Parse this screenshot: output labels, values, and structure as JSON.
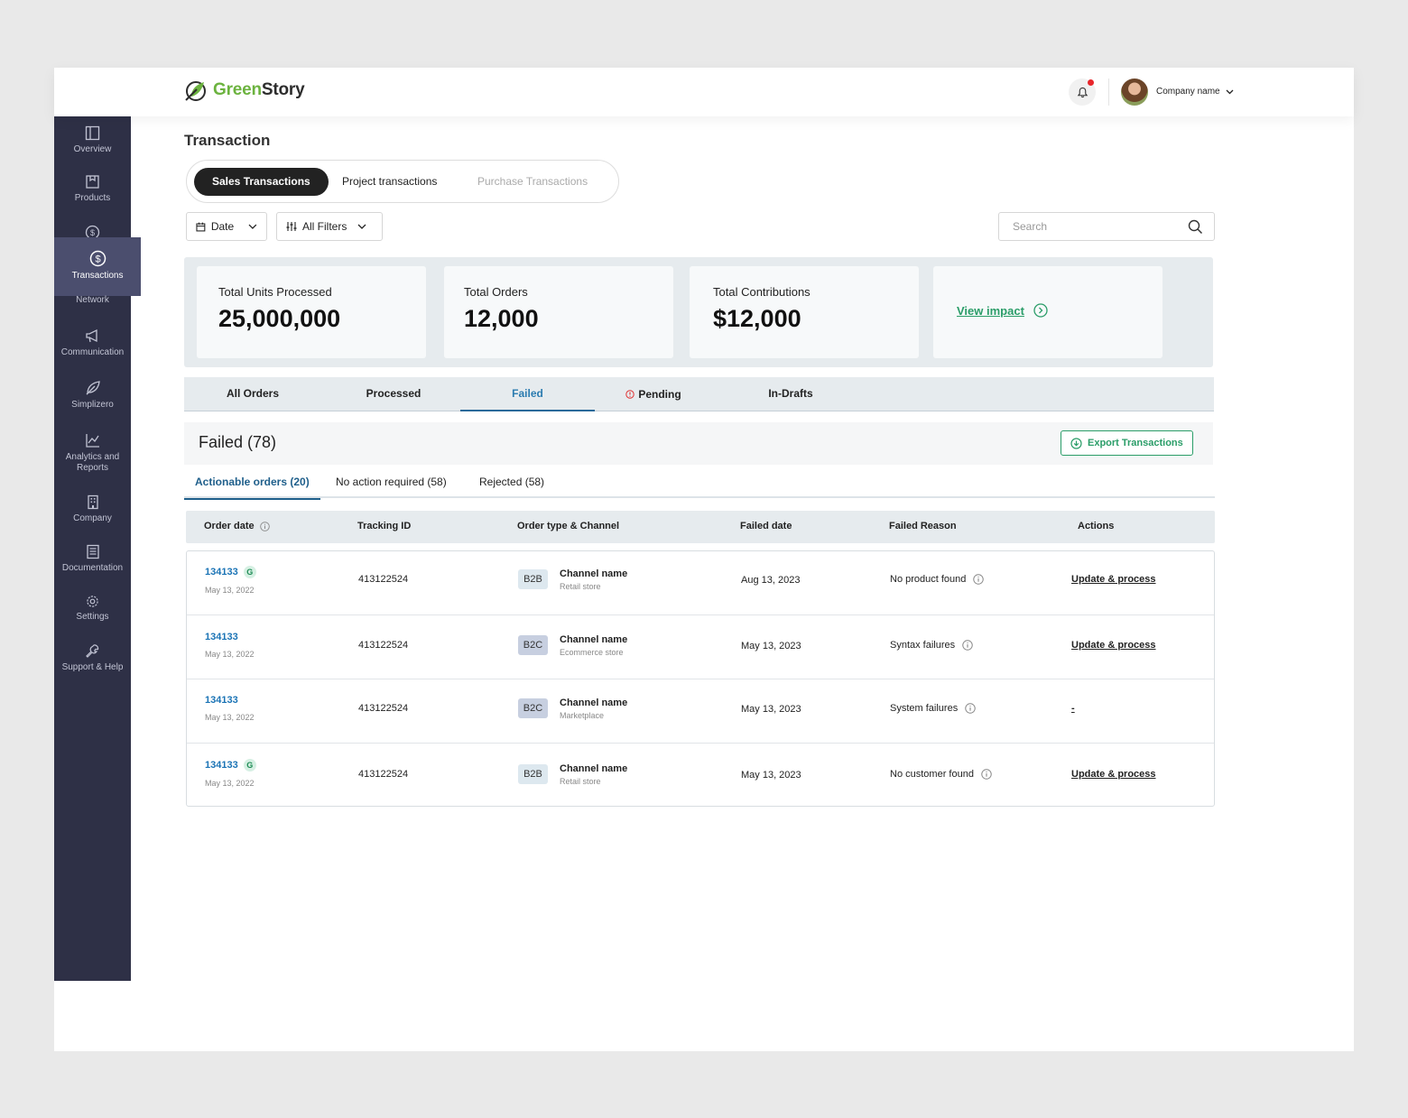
{
  "header": {
    "logo_green": "Green",
    "logo_dark": "Story",
    "company_name": "Company name"
  },
  "sidebar": {
    "items": [
      {
        "label": "Overview",
        "icon": "layout-icon"
      },
      {
        "label": "Products",
        "icon": "box-icon"
      },
      {
        "label": "Transactions",
        "icon": "dollar-circle-icon",
        "active": true
      },
      {
        "label": "Network",
        "icon": "network-icon"
      },
      {
        "label": "Communication",
        "icon": "megaphone-icon"
      },
      {
        "label": "Simplizero",
        "icon": "leaf-icon"
      },
      {
        "label": "Analytics and Reports",
        "icon": "chart-line-icon"
      },
      {
        "label": "Company",
        "icon": "building-icon"
      },
      {
        "label": "Documentation",
        "icon": "document-icon"
      },
      {
        "label": "Settings",
        "icon": "gear-icon"
      },
      {
        "label": "Support & Help",
        "icon": "wrench-icon"
      }
    ],
    "analytics_line1": "Analytics and",
    "analytics_line2": "Reports"
  },
  "page": {
    "title": "Transaction",
    "segments": [
      "Sales Transactions",
      "Project transactions",
      "Purchase Transactions"
    ],
    "filters": {
      "date": "Date",
      "all_filters": "All Filters"
    },
    "search_placeholder": "Search"
  },
  "stats": {
    "units_label": "Total Units Processed",
    "units_value": "25,000,000",
    "orders_label": "Total Orders",
    "orders_value": "12,000",
    "contrib_label": "Total Contributions",
    "contrib_value": "$12,000",
    "view_impact": "View impact"
  },
  "tabs": [
    "All Orders",
    "Processed",
    "Failed",
    "Pending",
    "In-Drafts"
  ],
  "failed": {
    "title": "Failed (78)",
    "export_label": "Export Transactions"
  },
  "subtabs": [
    "Actionable orders (20)",
    "No action required (58)",
    "Rejected (58)"
  ],
  "table": {
    "columns": [
      "Order date",
      "Tracking ID",
      "Order type & Channel",
      "Failed date",
      "Failed Reason",
      "Actions"
    ],
    "rows": [
      {
        "order_id": "134133",
        "g": "G",
        "order_date": "May 13, 2022",
        "tracking": "413122524",
        "type": "B2B",
        "channel": "Channel name",
        "channel_sub": "Retail store",
        "failed_date": "Aug 13, 2023",
        "reason": "No product found",
        "action": "Update & process"
      },
      {
        "order_id": "134133",
        "g": "",
        "order_date": "May 13, 2022",
        "tracking": "413122524",
        "type": "B2C",
        "channel": "Channel name",
        "channel_sub": "Ecommerce store",
        "failed_date": "May 13, 2023",
        "reason": "Syntax failures",
        "action": "Update & process"
      },
      {
        "order_id": "134133",
        "g": "",
        "order_date": "May 13, 2022",
        "tracking": "413122524",
        "type": "B2C",
        "channel": "Channel name",
        "channel_sub": "Marketplace",
        "failed_date": "May 13, 2023",
        "reason": "System failures",
        "action": "-"
      },
      {
        "order_id": "134133",
        "g": "G",
        "order_date": "May 13, 2022",
        "tracking": "413122524",
        "type": "B2B",
        "channel": "Channel name",
        "channel_sub": "Retail store",
        "failed_date": "May 13, 2023",
        "reason": "No customer found",
        "action": "Update & process"
      }
    ]
  },
  "colors": {
    "sidebar_bg": "#2e3046",
    "sidebar_active": "#4b4e6e",
    "brand_green": "#6cb33f",
    "accent_green": "#2a9d68",
    "link_blue": "#1a73b5",
    "b2b_badge": "#dde8ef",
    "b2c_badge": "#c7cfe0"
  }
}
